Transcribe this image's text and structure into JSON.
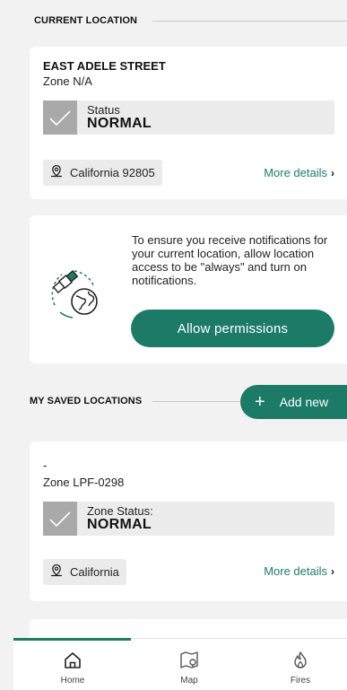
{
  "current_location": {
    "section_label": "CURRENT LOCATION",
    "street": "EAST ADELE STREET",
    "zone": "Zone N/A",
    "status_caption": "Status",
    "status_value": "NORMAL",
    "region": "California 92805",
    "more_details": "More details",
    "more_chevron": "›"
  },
  "permission": {
    "text": "To ensure you receive notifications for your current location, allow location access to be \"always\" and turn on notifications.",
    "button_label": "Allow permissions"
  },
  "saved_locations": {
    "section_label": "MY SAVED LOCATIONS",
    "add_plus": "+",
    "add_label": "Add new",
    "items": [
      {
        "name": "-",
        "zone": "Zone LPF-0298",
        "status_caption": "Zone Status:",
        "status_value": "NORMAL",
        "region": "California",
        "more_details": "More details",
        "more_chevron": "›"
      }
    ]
  },
  "tabs": [
    {
      "label": "Home",
      "icon": "home-icon",
      "active": true
    },
    {
      "label": "Map",
      "icon": "map-icon",
      "active": false
    },
    {
      "label": "Fires",
      "icon": "flame-icon",
      "active": false
    }
  ],
  "colors": {
    "accent": "#1c7b66",
    "status_check_bg": "#a9a9aa",
    "background": "#f2f2f2"
  }
}
